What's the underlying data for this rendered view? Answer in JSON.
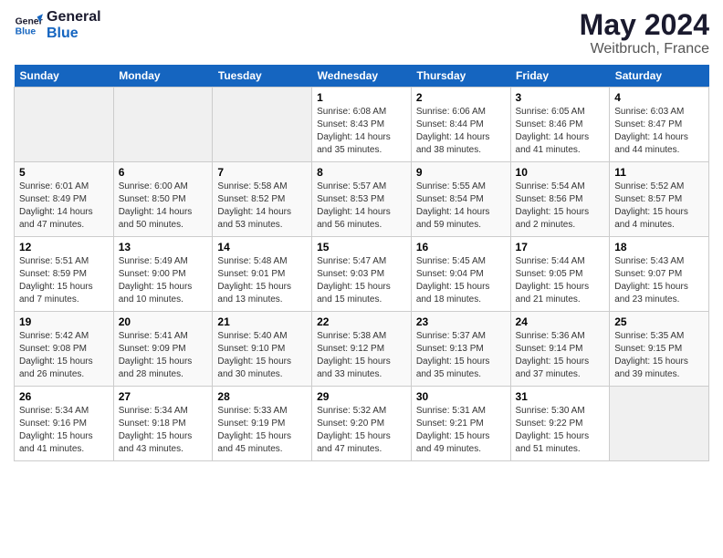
{
  "logo": {
    "line1": "General",
    "line2": "Blue"
  },
  "title": "May 2024",
  "subtitle": "Weitbruch, France",
  "days_header": [
    "Sunday",
    "Monday",
    "Tuesday",
    "Wednesday",
    "Thursday",
    "Friday",
    "Saturday"
  ],
  "weeks": [
    [
      {
        "num": "",
        "info": ""
      },
      {
        "num": "",
        "info": ""
      },
      {
        "num": "",
        "info": ""
      },
      {
        "num": "1",
        "info": "Sunrise: 6:08 AM\nSunset: 8:43 PM\nDaylight: 14 hours\nand 35 minutes."
      },
      {
        "num": "2",
        "info": "Sunrise: 6:06 AM\nSunset: 8:44 PM\nDaylight: 14 hours\nand 38 minutes."
      },
      {
        "num": "3",
        "info": "Sunrise: 6:05 AM\nSunset: 8:46 PM\nDaylight: 14 hours\nand 41 minutes."
      },
      {
        "num": "4",
        "info": "Sunrise: 6:03 AM\nSunset: 8:47 PM\nDaylight: 14 hours\nand 44 minutes."
      }
    ],
    [
      {
        "num": "5",
        "info": "Sunrise: 6:01 AM\nSunset: 8:49 PM\nDaylight: 14 hours\nand 47 minutes."
      },
      {
        "num": "6",
        "info": "Sunrise: 6:00 AM\nSunset: 8:50 PM\nDaylight: 14 hours\nand 50 minutes."
      },
      {
        "num": "7",
        "info": "Sunrise: 5:58 AM\nSunset: 8:52 PM\nDaylight: 14 hours\nand 53 minutes."
      },
      {
        "num": "8",
        "info": "Sunrise: 5:57 AM\nSunset: 8:53 PM\nDaylight: 14 hours\nand 56 minutes."
      },
      {
        "num": "9",
        "info": "Sunrise: 5:55 AM\nSunset: 8:54 PM\nDaylight: 14 hours\nand 59 minutes."
      },
      {
        "num": "10",
        "info": "Sunrise: 5:54 AM\nSunset: 8:56 PM\nDaylight: 15 hours\nand 2 minutes."
      },
      {
        "num": "11",
        "info": "Sunrise: 5:52 AM\nSunset: 8:57 PM\nDaylight: 15 hours\nand 4 minutes."
      }
    ],
    [
      {
        "num": "12",
        "info": "Sunrise: 5:51 AM\nSunset: 8:59 PM\nDaylight: 15 hours\nand 7 minutes."
      },
      {
        "num": "13",
        "info": "Sunrise: 5:49 AM\nSunset: 9:00 PM\nDaylight: 15 hours\nand 10 minutes."
      },
      {
        "num": "14",
        "info": "Sunrise: 5:48 AM\nSunset: 9:01 PM\nDaylight: 15 hours\nand 13 minutes."
      },
      {
        "num": "15",
        "info": "Sunrise: 5:47 AM\nSunset: 9:03 PM\nDaylight: 15 hours\nand 15 minutes."
      },
      {
        "num": "16",
        "info": "Sunrise: 5:45 AM\nSunset: 9:04 PM\nDaylight: 15 hours\nand 18 minutes."
      },
      {
        "num": "17",
        "info": "Sunrise: 5:44 AM\nSunset: 9:05 PM\nDaylight: 15 hours\nand 21 minutes."
      },
      {
        "num": "18",
        "info": "Sunrise: 5:43 AM\nSunset: 9:07 PM\nDaylight: 15 hours\nand 23 minutes."
      }
    ],
    [
      {
        "num": "19",
        "info": "Sunrise: 5:42 AM\nSunset: 9:08 PM\nDaylight: 15 hours\nand 26 minutes."
      },
      {
        "num": "20",
        "info": "Sunrise: 5:41 AM\nSunset: 9:09 PM\nDaylight: 15 hours\nand 28 minutes."
      },
      {
        "num": "21",
        "info": "Sunrise: 5:40 AM\nSunset: 9:10 PM\nDaylight: 15 hours\nand 30 minutes."
      },
      {
        "num": "22",
        "info": "Sunrise: 5:38 AM\nSunset: 9:12 PM\nDaylight: 15 hours\nand 33 minutes."
      },
      {
        "num": "23",
        "info": "Sunrise: 5:37 AM\nSunset: 9:13 PM\nDaylight: 15 hours\nand 35 minutes."
      },
      {
        "num": "24",
        "info": "Sunrise: 5:36 AM\nSunset: 9:14 PM\nDaylight: 15 hours\nand 37 minutes."
      },
      {
        "num": "25",
        "info": "Sunrise: 5:35 AM\nSunset: 9:15 PM\nDaylight: 15 hours\nand 39 minutes."
      }
    ],
    [
      {
        "num": "26",
        "info": "Sunrise: 5:34 AM\nSunset: 9:16 PM\nDaylight: 15 hours\nand 41 minutes."
      },
      {
        "num": "27",
        "info": "Sunrise: 5:34 AM\nSunset: 9:18 PM\nDaylight: 15 hours\nand 43 minutes."
      },
      {
        "num": "28",
        "info": "Sunrise: 5:33 AM\nSunset: 9:19 PM\nDaylight: 15 hours\nand 45 minutes."
      },
      {
        "num": "29",
        "info": "Sunrise: 5:32 AM\nSunset: 9:20 PM\nDaylight: 15 hours\nand 47 minutes."
      },
      {
        "num": "30",
        "info": "Sunrise: 5:31 AM\nSunset: 9:21 PM\nDaylight: 15 hours\nand 49 minutes."
      },
      {
        "num": "31",
        "info": "Sunrise: 5:30 AM\nSunset: 9:22 PM\nDaylight: 15 hours\nand 51 minutes."
      },
      {
        "num": "",
        "info": ""
      }
    ]
  ]
}
